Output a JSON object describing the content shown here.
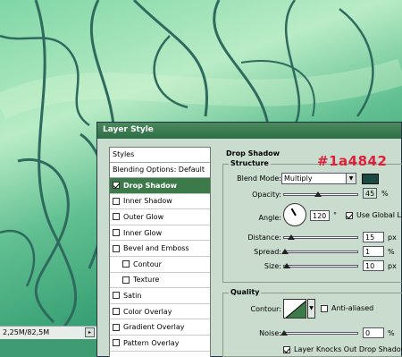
{
  "window": {
    "title": "Layer Style"
  },
  "status_bar": {
    "doc_size": "2,25M/82,5M",
    "arrow": "▸"
  },
  "styles_panel": {
    "header": "Styles",
    "blending_options": "Blending Options: Default",
    "items": [
      {
        "label": "Drop Shadow",
        "checked": true,
        "selected": true,
        "sub": false
      },
      {
        "label": "Inner Shadow",
        "checked": false,
        "selected": false,
        "sub": false
      },
      {
        "label": "Outer Glow",
        "checked": false,
        "selected": false,
        "sub": false
      },
      {
        "label": "Inner Glow",
        "checked": false,
        "selected": false,
        "sub": false
      },
      {
        "label": "Bevel and Emboss",
        "checked": false,
        "selected": false,
        "sub": false
      },
      {
        "label": "Contour",
        "checked": false,
        "selected": false,
        "sub": true
      },
      {
        "label": "Texture",
        "checked": false,
        "selected": false,
        "sub": true
      },
      {
        "label": "Satin",
        "checked": false,
        "selected": false,
        "sub": false
      },
      {
        "label": "Color Overlay",
        "checked": false,
        "selected": false,
        "sub": false
      },
      {
        "label": "Gradient Overlay",
        "checked": false,
        "selected": false,
        "sub": false
      },
      {
        "label": "Pattern Overlay",
        "checked": false,
        "selected": false,
        "sub": false
      }
    ]
  },
  "drop_shadow": {
    "section_title": "Drop Shadow",
    "structure": {
      "title": "Structure",
      "blend_mode_label": "Blend Mode:",
      "blend_mode_value": "Multiply",
      "shadow_color": "#1a4842",
      "hex_annotation": "#1a4842",
      "opacity_label": "Opacity:",
      "opacity_value": "45",
      "opacity_unit": "%",
      "opacity_fraction": 0.45,
      "angle_label": "Angle:",
      "angle_value": "120",
      "angle_unit": "°",
      "use_global_light_label": "Use Global Li",
      "use_global_light": true,
      "distance_label": "Distance:",
      "distance_value": "15",
      "distance_unit": "px",
      "spread_label": "Spread:",
      "spread_value": "1",
      "spread_unit": "%",
      "size_label": "Size:",
      "size_value": "10",
      "size_unit": "px"
    },
    "quality": {
      "title": "Quality",
      "contour_label": "Contour:",
      "anti_aliased_label": "Anti-aliased",
      "anti_aliased": false,
      "noise_label": "Noise:",
      "noise_value": "0",
      "noise_unit": "%"
    },
    "layer_knocks_out_label": "Layer Knocks Out Drop Shadow",
    "layer_knocks_out": true
  },
  "colors": {
    "accent": "#3c7a4a",
    "title_bar": "#2d6e45",
    "annotation": "#e0203a"
  }
}
